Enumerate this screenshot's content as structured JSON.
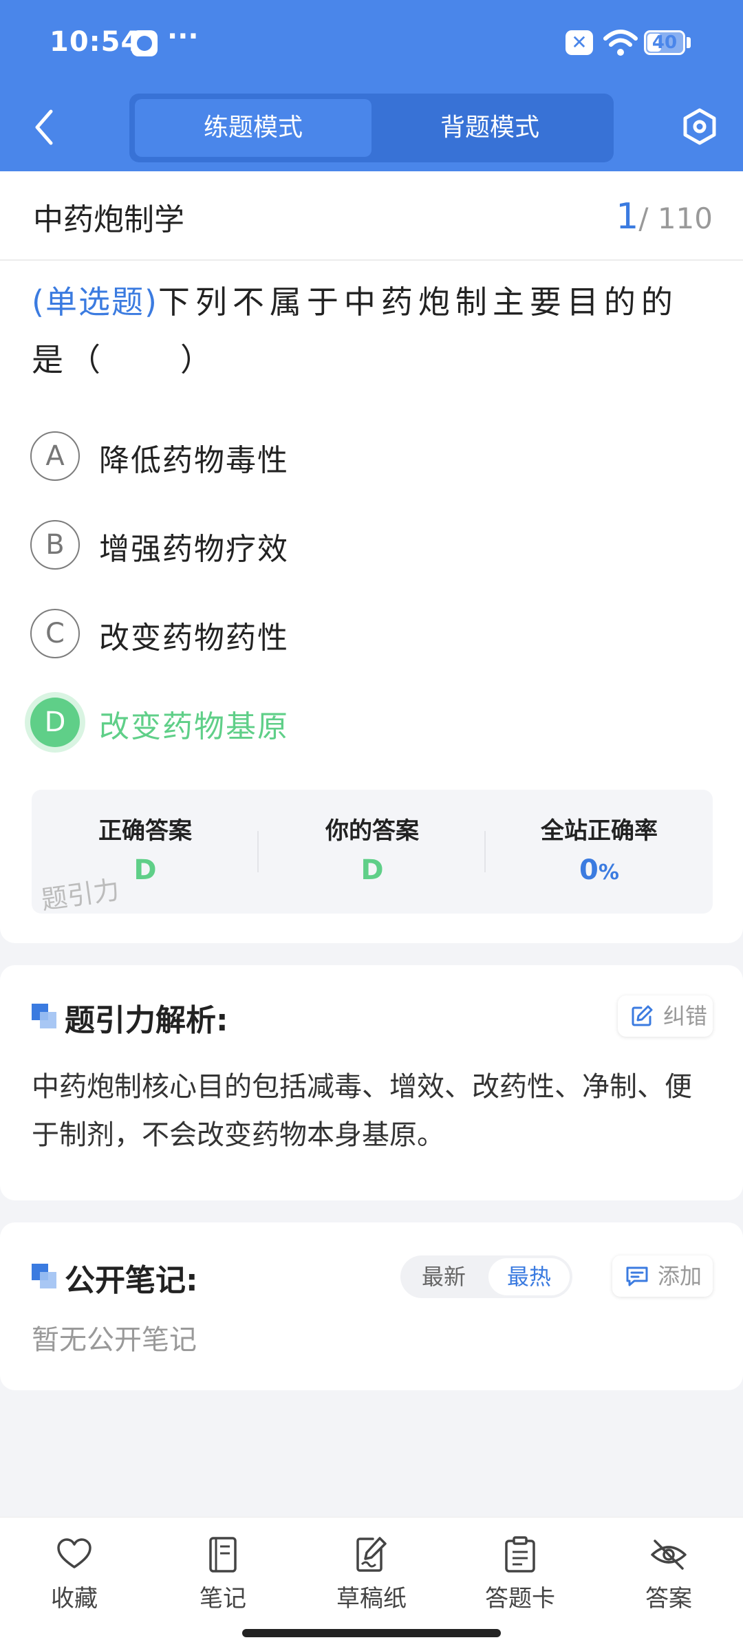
{
  "status_bar": {
    "time": "10:54",
    "dots": "···",
    "battery": "40",
    "battery_level": 0.4
  },
  "header": {
    "tabs": [
      {
        "label": "练题模式",
        "active": true
      },
      {
        "label": "背题模式",
        "active": false
      }
    ],
    "back_icon": "chevron-left-icon",
    "settings_icon": "settings-hexagon-icon",
    "color": "#4a86ea"
  },
  "question": {
    "subject": "中药炮制学",
    "current": "1",
    "total": "/ 110",
    "type": "(单选题)",
    "text": "下列不属于中药炮制主要目的的是（　　）",
    "options": [
      {
        "letter": "A",
        "text": "降低药物毒性"
      },
      {
        "letter": "B",
        "text": "增强药物疗效"
      },
      {
        "letter": "C",
        "text": "改变药物药性"
      },
      {
        "letter": "D",
        "text": "改变药物基原",
        "correct": true
      }
    ],
    "correct_color": "#5fcf88"
  },
  "answer_panel": {
    "correct_label": "正确答案",
    "correct_value": "D",
    "yours_label": "你的答案",
    "yours_value": "D",
    "rate_label": "全站正确率",
    "rate_value": "0",
    "rate_unit": "%",
    "watermark": "题引力"
  },
  "analysis": {
    "title": "题引力解析:",
    "report_button": "纠错",
    "text": "中药炮制核心目的包括减毒、增效、改药性、净制、便于制剂，不会改变药物本身基原。"
  },
  "notes": {
    "title": "公开笔记:",
    "sort_latest": "最新",
    "sort_hot": "最热",
    "add_button": "添加",
    "empty_text": "暂无公开笔记"
  },
  "bottom_bar": {
    "items": [
      {
        "label": "收藏",
        "icon": "heart-icon"
      },
      {
        "label": "笔记",
        "icon": "notebook-icon"
      },
      {
        "label": "草稿纸",
        "icon": "draft-icon"
      },
      {
        "label": "答题卡",
        "icon": "answer-card-icon"
      },
      {
        "label": "答案",
        "icon": "eye-off-icon"
      }
    ]
  }
}
